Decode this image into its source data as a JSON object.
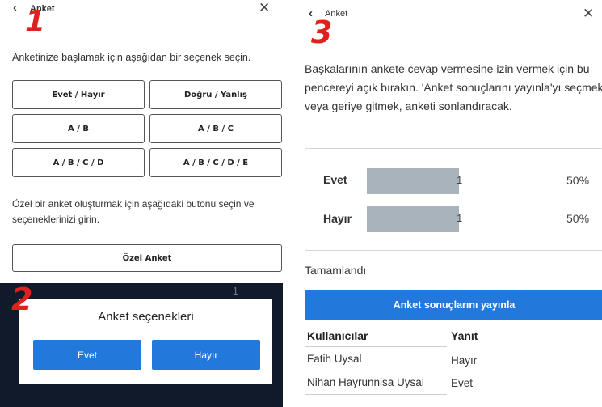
{
  "annotations": {
    "step1": "1",
    "step2": "2",
    "step3": "3"
  },
  "panel1": {
    "header": {
      "back_glyph": "‹",
      "title": "Anket",
      "close_glyph": "✕"
    },
    "intro": "Anketinize başlamak için aşağıdan bir seçenek seçin.",
    "options": [
      "Evet / Hayır",
      "Doğru / Yanlış",
      "A / B",
      "A / B / C",
      "A / B / C / D",
      "A / B / C / D / E"
    ],
    "custom_desc": "Özel bir anket oluşturmak için aşağıdaki butonu seçin ve seçeneklerinizi girin.",
    "custom_button": "Özel Anket"
  },
  "panel2": {
    "top_number": "1",
    "dialog_title": "Anket seçenekleri",
    "yes_button": "Evet",
    "no_button": "Hayır"
  },
  "panel3": {
    "header": {
      "back_glyph": "‹",
      "title": "Anket",
      "close_glyph": "✕"
    },
    "description": "Başkalarının ankete cevap vermesine izin vermek için bu pencereyi açık bırakın. 'Anket sonuçlarını yayınla'yı seçmek veya geriye gitmek, anketi sonlandıracak.",
    "results": [
      {
        "label": "Evet",
        "count": "1",
        "percent": "50%",
        "share": 0.5
      },
      {
        "label": "Hayır",
        "count": "1",
        "percent": "50%",
        "share": 0.5
      }
    ],
    "status": "Tamamlandı",
    "publish_button": "Anket sonuçlarını yayınla",
    "table": {
      "headers": [
        "Kullanıcılar",
        "Yanıt"
      ],
      "rows": [
        [
          "Fatih Uysal",
          "Hayır"
        ],
        [
          "Nihan Hayrunnisa Uysal",
          "Evet"
        ]
      ]
    }
  },
  "colors": {
    "accent": "#2378dc",
    "annotation": "#e0201e",
    "bar": "#a9b3bb",
    "backdrop": "#111a2b"
  }
}
